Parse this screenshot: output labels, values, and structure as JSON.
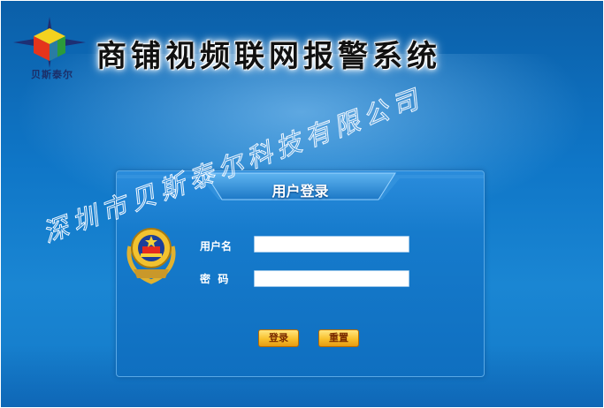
{
  "logo": {
    "icon": "compass-cube-logo",
    "text": "贝斯泰尔"
  },
  "header": {
    "title": "商铺视频联网报警系统"
  },
  "login_panel": {
    "title": "用户登录",
    "emblem_icon": "police-emblem-icon",
    "username_label": "用户名",
    "username_value": "",
    "password_label": "密  码",
    "password_value": "",
    "login_button": "登录",
    "reset_button": "重置"
  },
  "watermark": "深圳市贝斯泰尔科技有限公司",
  "colors": {
    "background": "#0f76c7",
    "button": "#f8c02c",
    "title": "#111111"
  }
}
